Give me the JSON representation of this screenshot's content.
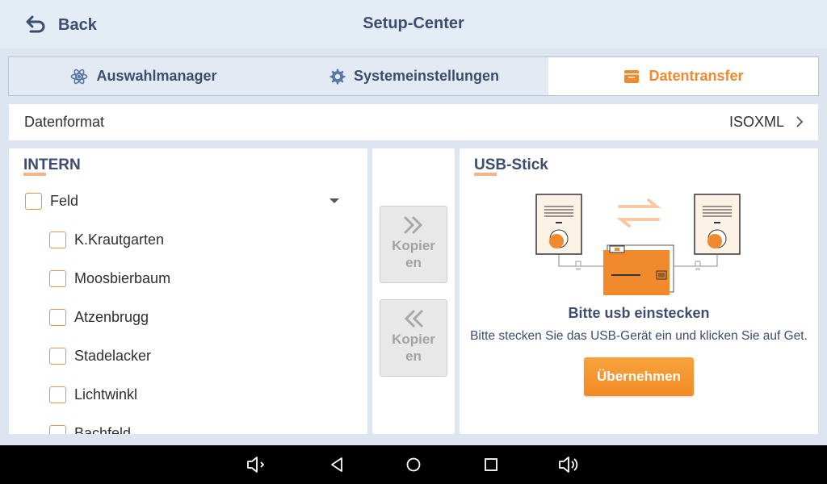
{
  "header": {
    "back_label": "Back",
    "title": "Setup-Center"
  },
  "tabs": [
    {
      "label": "Auswahlmanager",
      "icon": "atom-icon",
      "active": false
    },
    {
      "label": "Systemeinstellungen",
      "icon": "gear-icon",
      "active": false
    },
    {
      "label": "Datentransfer",
      "icon": "folder-icon",
      "active": true
    }
  ],
  "format": {
    "label": "Datenformat",
    "value": "ISOXML"
  },
  "intern": {
    "title": "INTERN",
    "root": {
      "label": "Feld",
      "checked": false,
      "expanded": true
    },
    "children": [
      {
        "label": "K.Krautgarten",
        "checked": false
      },
      {
        "label": "Moosbierbaum",
        "checked": false
      },
      {
        "label": "Atzenbrugg",
        "checked": false
      },
      {
        "label": "Stadelacker",
        "checked": false
      },
      {
        "label": "Lichtwinkl",
        "checked": false
      },
      {
        "label": "Bachfeld",
        "checked": false
      }
    ]
  },
  "copy": {
    "to_usb_label": "Kopieren",
    "to_intern_label": "Kopieren"
  },
  "usb": {
    "title": "USB-Stick",
    "status_title": "Bitte usb einstecken",
    "status_text": "Bitte stecken Sie das USB-Gerät ein und klicken Sie auf Get.",
    "apply_label": "Übernehmen"
  },
  "colors": {
    "accent": "#f08a2d",
    "text_dark": "#3c4d6d",
    "background": "#dde6f0"
  }
}
